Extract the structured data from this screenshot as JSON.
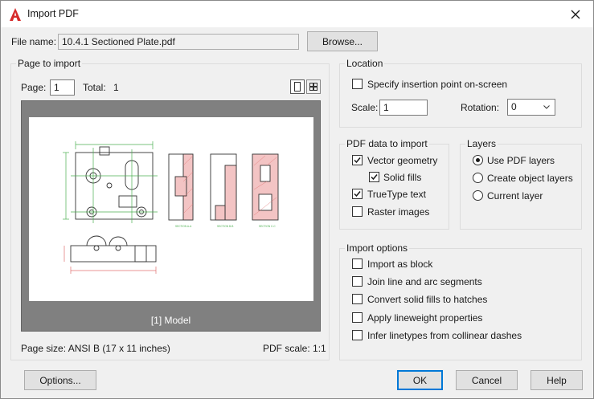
{
  "titlebar": {
    "title": "Import PDF"
  },
  "file": {
    "label": "File name:",
    "value": "10.4.1 Sectioned Plate.pdf",
    "browse_label": "Browse..."
  },
  "page_to_import": {
    "title": "Page to import",
    "page_label": "Page:",
    "page_value": "1",
    "total_label": "Total:",
    "total_value": "1",
    "preview_caption": "[1] Model",
    "page_size_label": "Page size:",
    "page_size_value": "ANSI B (17 x 11 inches)",
    "pdf_scale_label": "PDF scale:",
    "pdf_scale_value": "1:1"
  },
  "location": {
    "title": "Location",
    "specify_label": "Specify insertion point on-screen",
    "specify_checked": false,
    "scale_label": "Scale:",
    "scale_value": "1",
    "rotation_label": "Rotation:",
    "rotation_value": "0"
  },
  "pdf_data": {
    "title": "PDF data to import",
    "vector_label": "Vector geometry",
    "vector_checked": true,
    "solid_label": "Solid fills",
    "solid_checked": true,
    "truetype_label": "TrueType text",
    "truetype_checked": true,
    "raster_label": "Raster images",
    "raster_checked": false
  },
  "layers": {
    "title": "Layers",
    "options": [
      "Use PDF layers",
      "Create object layers",
      "Current layer"
    ],
    "selected_index": 0
  },
  "import_options": {
    "title": "Import options",
    "items": [
      "Import as block",
      "Join line and arc segments",
      "Convert solid fills to hatches",
      "Apply lineweight properties",
      "Infer linetypes from collinear dashes"
    ]
  },
  "footer": {
    "options_label": "Options...",
    "ok_label": "OK",
    "cancel_label": "Cancel",
    "help_label": "Help"
  },
  "colors": {
    "accent": "#0078d7",
    "app_red": "#d62b2b",
    "preview_bg": "#808080",
    "drawing_green": "#4caf50",
    "hatch_red": "#e07070"
  },
  "icons": {
    "app": "autocad-a-icon",
    "close": "close-icon",
    "single_view": "single-page-view-icon",
    "grid_view": "grid-view-icon",
    "dropdown": "chevron-down-icon"
  }
}
